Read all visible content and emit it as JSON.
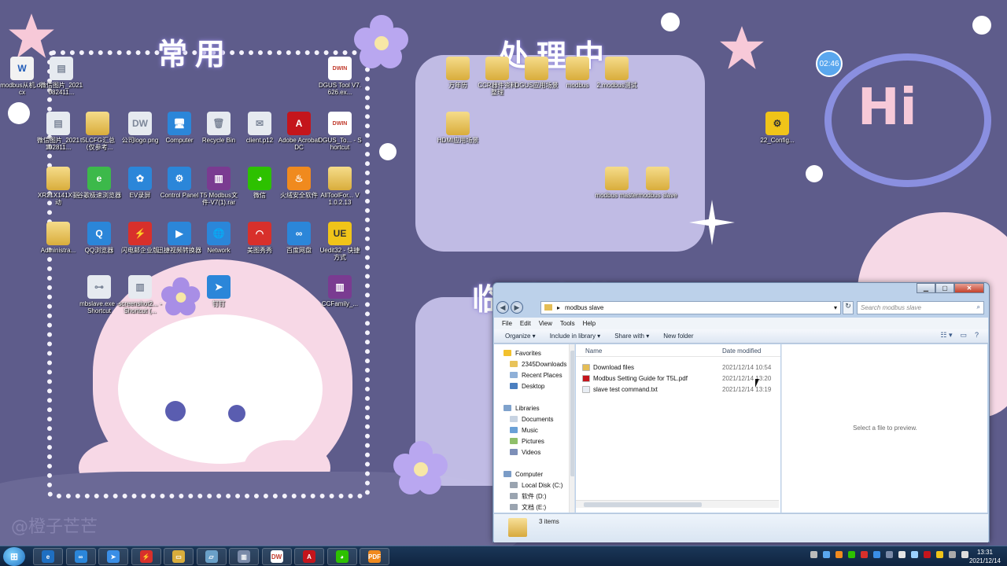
{
  "desktop": {
    "clock_bubble": "02:46",
    "titles": {
      "common": "常用",
      "processing": "处理中",
      "temp": "临时文件"
    },
    "watermark": "@橙子芒芒",
    "icons": [
      {
        "label": "modbus从机.docx",
        "icon": "word-doc-icon",
        "kind": "doc",
        "glyph": "W"
      },
      {
        "label": "微信图片_2021082411...",
        "icon": "image-file-icon",
        "kind": "img",
        "glyph": "▤"
      },
      {
        "label": "DGUS Tool V7.626.ex...",
        "icon": "dwin-app-icon",
        "kind": "dwin",
        "glyph": "DWIN"
      },
      {
        "label": "微信图片_2021102811...",
        "icon": "image-file-icon",
        "kind": "img",
        "glyph": "▤"
      },
      {
        "label": "t5LCFG汇总（仅参考...",
        "icon": "folder-icon",
        "kind": "folder",
        "glyph": ""
      },
      {
        "label": "公司logo.png",
        "icon": "image-file-icon",
        "kind": "img",
        "glyph": "DW"
      },
      {
        "label": "Computer",
        "icon": "computer-icon",
        "kind": "blue",
        "glyph": "🖥"
      },
      {
        "label": "Recycle Bin",
        "icon": "recycle-bin-icon",
        "kind": "img",
        "glyph": "🗑"
      },
      {
        "label": "client.p12",
        "icon": "certificate-icon",
        "kind": "img",
        "glyph": "✉"
      },
      {
        "label": "Adobe Acrobat DC",
        "icon": "acrobat-icon",
        "kind": "pdf",
        "glyph": "A"
      },
      {
        "label": "DGUS_To... - Shortcut",
        "icon": "dwin-app-icon",
        "kind": "dwin",
        "glyph": "DWIN"
      },
      {
        "label": "XR21X141X驱动",
        "icon": "folder-icon",
        "kind": "folder",
        "glyph": ""
      },
      {
        "label": "谷歌极速浏览器",
        "icon": "browser-icon",
        "kind": "green",
        "glyph": "e"
      },
      {
        "label": "EV录屏",
        "icon": "ev-recorder-icon",
        "kind": "blue",
        "glyph": "✿"
      },
      {
        "label": "Control Panel",
        "icon": "control-panel-icon",
        "kind": "blue",
        "glyph": "⚙"
      },
      {
        "label": "T5 Modbus文件-V7(1).rar",
        "icon": "rar-archive-icon",
        "kind": "rar",
        "glyph": "▥"
      },
      {
        "label": "微信",
        "icon": "wechat-icon",
        "kind": "wechat",
        "glyph": "◕"
      },
      {
        "label": "火绒安全软件",
        "icon": "huorong-icon",
        "kind": "orange",
        "glyph": "♨"
      },
      {
        "label": "AllToolFor... V1.0.2.13",
        "icon": "folder-icon",
        "kind": "folder",
        "glyph": ""
      },
      {
        "label": "Administra...",
        "icon": "user-folder-icon",
        "kind": "folder",
        "glyph": ""
      },
      {
        "label": "QQ浏览器",
        "icon": "qq-browser-icon",
        "kind": "blue",
        "glyph": "Q"
      },
      {
        "label": "闪电邮企业版",
        "icon": "mail-app-icon",
        "kind": "red",
        "glyph": "⚡"
      },
      {
        "label": "迅捷视频转换器",
        "icon": "video-converter-icon",
        "kind": "blue",
        "glyph": "▶"
      },
      {
        "label": "Network",
        "icon": "network-icon",
        "kind": "blue",
        "glyph": "🌐"
      },
      {
        "label": "美图秀秀",
        "icon": "meitu-icon",
        "kind": "red",
        "glyph": "◠"
      },
      {
        "label": "百度网盘",
        "icon": "baidu-netdisk-icon",
        "kind": "blue",
        "glyph": "∞"
      },
      {
        "label": "Uedit32 - 快捷方式",
        "icon": "ultraedit-icon",
        "kind": "ue",
        "glyph": "UE"
      },
      {
        "label": "mbslave.exe - Shortcut",
        "icon": "network-tree-icon",
        "kind": "img",
        "glyph": "⊶"
      },
      {
        "label": "screenshot2... - Shortcut (...",
        "icon": "building-icon",
        "kind": "img",
        "glyph": "▥"
      },
      {
        "label": "钉钉",
        "icon": "dingtalk-icon",
        "kind": "blue",
        "glyph": "➤"
      },
      {
        "label": "CCFamily_...",
        "icon": "rar-archive-icon",
        "kind": "rar",
        "glyph": "▥"
      },
      {
        "label": "万年历",
        "icon": "folder-icon",
        "kind": "folder",
        "glyph": ""
      },
      {
        "label": "CCR器件资料整理",
        "icon": "folder-icon",
        "kind": "folder",
        "glyph": ""
      },
      {
        "label": "DGUS应用场景",
        "icon": "folder-icon",
        "kind": "folder",
        "glyph": ""
      },
      {
        "label": "modbus",
        "icon": "folder-icon",
        "kind": "folder",
        "glyph": ""
      },
      {
        "label": "2.modbus测试",
        "icon": "folder-icon",
        "kind": "folder",
        "glyph": ""
      },
      {
        "label": "HDMI应用场景",
        "icon": "folder-icon",
        "kind": "folder",
        "glyph": ""
      },
      {
        "label": "modbus master",
        "icon": "folder-icon",
        "kind": "folder",
        "glyph": ""
      },
      {
        "label": "modbus slave",
        "icon": "folder-icon",
        "kind": "folder",
        "glyph": ""
      },
      {
        "label": "22_Config...",
        "icon": "config-app-icon",
        "kind": "ue",
        "glyph": "⚙"
      }
    ]
  },
  "explorer": {
    "path": "modbus slave",
    "search_placeholder": "Search modbus slave",
    "menu": [
      "File",
      "Edit",
      "View",
      "Tools",
      "Help"
    ],
    "toolbar": [
      "Organize ▾",
      "Include in library ▾",
      "Share with ▾",
      "New folder"
    ],
    "nav": [
      {
        "label": "Favorites",
        "color": "#f2c12e",
        "indent": 0
      },
      {
        "label": "2345Downloads",
        "color": "#e8c35a",
        "indent": 1
      },
      {
        "label": "Recent Places",
        "color": "#8fb0d8",
        "indent": 1
      },
      {
        "label": "Desktop",
        "color": "#4b7fc0",
        "indent": 1
      },
      {
        "label": "",
        "color": "transparent",
        "indent": 0
      },
      {
        "label": "Libraries",
        "color": "#7fa2cc",
        "indent": 0
      },
      {
        "label": "Documents",
        "color": "#c7d3e2",
        "indent": 1
      },
      {
        "label": "Music",
        "color": "#6aa0d6",
        "indent": 1
      },
      {
        "label": "Pictures",
        "color": "#8fbf6a",
        "indent": 1
      },
      {
        "label": "Videos",
        "color": "#7d8fb8",
        "indent": 1
      },
      {
        "label": "",
        "color": "transparent",
        "indent": 0
      },
      {
        "label": "Computer",
        "color": "#7b9cc7",
        "indent": 0
      },
      {
        "label": "Local Disk (C:)",
        "color": "#9aa4b0",
        "indent": 1
      },
      {
        "label": "软件 (D:)",
        "color": "#9aa4b0",
        "indent": 1
      },
      {
        "label": "文档 (E:)",
        "color": "#9aa4b0",
        "indent": 1
      }
    ],
    "columns": {
      "name": "Name",
      "date": "Date modified"
    },
    "files": [
      {
        "name": "Download files",
        "date": "2021/12/14 10:54",
        "icon": "folder-icon",
        "color": "#e4bd55"
      },
      {
        "name": "Modbus Setting Guide for T5L.pdf",
        "date": "2021/12/14 13:20",
        "icon": "pdf-file-icon",
        "color": "#c4151c"
      },
      {
        "name": "slave test command.txt",
        "date": "2021/12/14 13:19",
        "icon": "text-file-icon",
        "color": "#e9eef4"
      }
    ],
    "preview_msg": "Select a file to preview.",
    "item_count": "3 items"
  },
  "taskbar": {
    "apps": [
      {
        "name": "taskbar-ie-icon",
        "color": "#1f6fc1",
        "glyph": "e"
      },
      {
        "name": "taskbar-baidu-netdisk-icon",
        "color": "#2b86d9",
        "glyph": "∞"
      },
      {
        "name": "taskbar-dingtalk-icon",
        "color": "#3a8ee6",
        "glyph": "➤"
      },
      {
        "name": "taskbar-mail-icon",
        "color": "#d8302b",
        "glyph": "⚡"
      },
      {
        "name": "taskbar-explorer-icon",
        "color": "#d9ad3c",
        "glyph": "▭"
      },
      {
        "name": "taskbar-notes-icon",
        "color": "#6aa0c8",
        "glyph": "▱"
      },
      {
        "name": "taskbar-building-icon",
        "color": "#7a8aa8",
        "glyph": "▥"
      },
      {
        "name": "taskbar-dwin-icon",
        "color": "#ffffff",
        "glyph": "DW"
      },
      {
        "name": "taskbar-acrobat-icon",
        "color": "#c4151c",
        "glyph": "A"
      },
      {
        "name": "taskbar-wechat-icon",
        "color": "#2dc100",
        "glyph": "◕"
      },
      {
        "name": "taskbar-pdf-icon",
        "color": "#f08a1e",
        "glyph": "PDF"
      }
    ],
    "time": "13:31",
    "date": "2021/12/14"
  }
}
